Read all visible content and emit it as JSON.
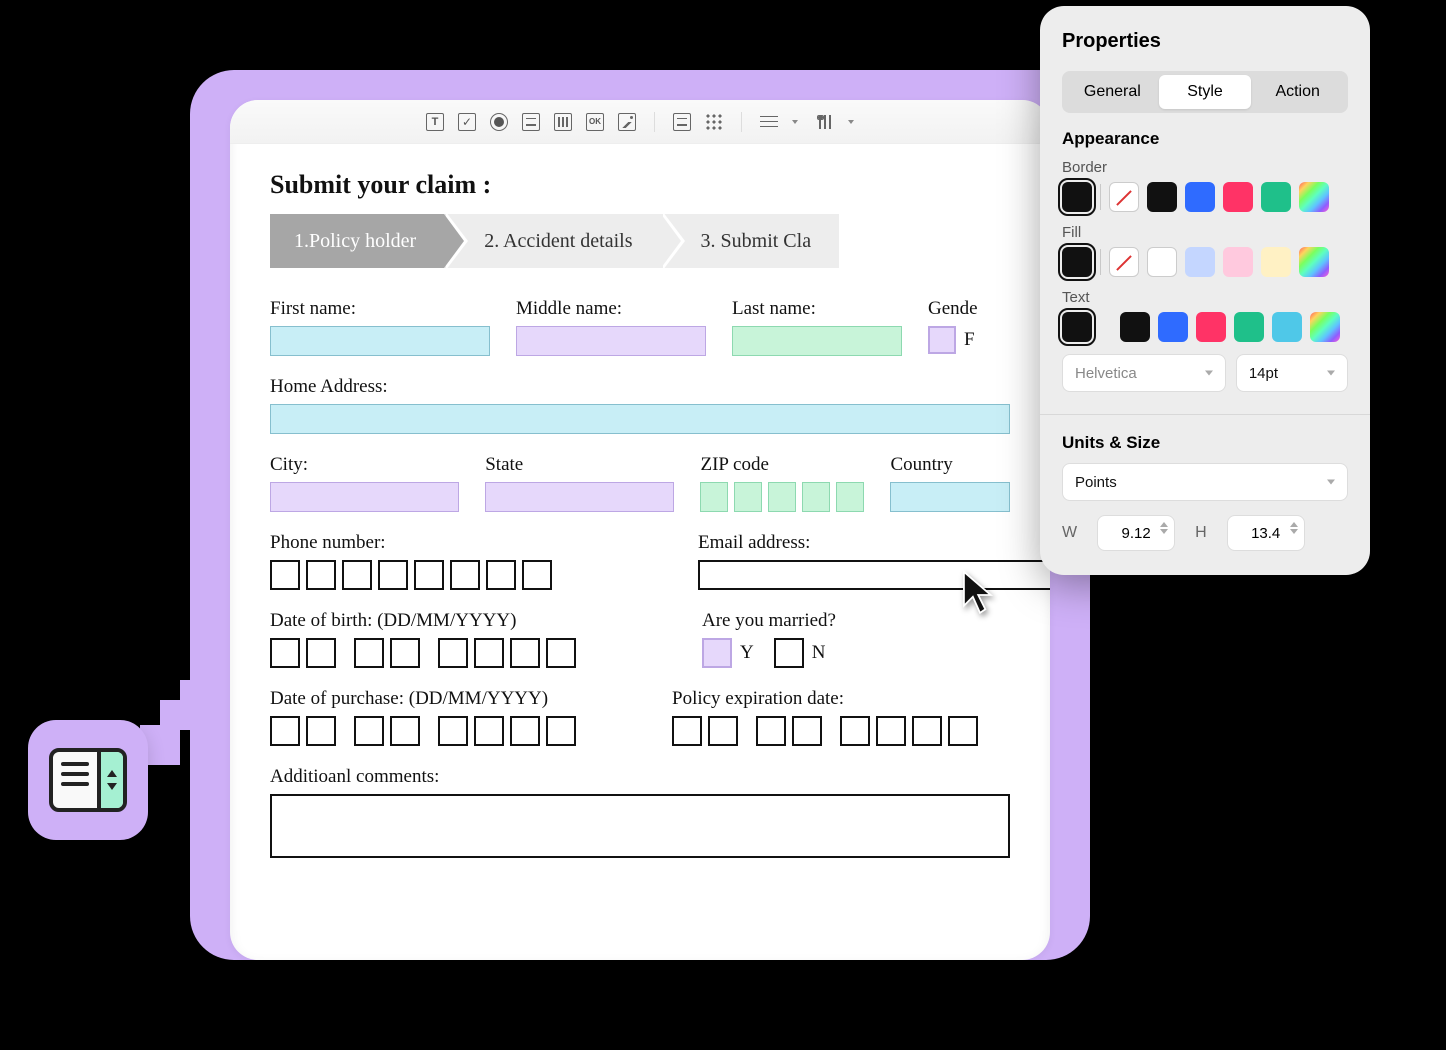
{
  "form": {
    "title": "Submit your claim :",
    "steps": [
      "1.Policy holder",
      "2. Accident details",
      "3. Submit Cla"
    ],
    "labels": {
      "first_name": "First name:",
      "middle_name": "Middle name:",
      "last_name": "Last name:",
      "gender": "Gende",
      "home_address": "Home Address:",
      "city": "City:",
      "state": "State",
      "zip": "ZIP code",
      "country": "Country",
      "phone": "Phone number:",
      "email": "Email address:",
      "dob": "Date of birth: (DD/MM/YYYY)",
      "married": "Are you married?",
      "dop": "Date of purchase: (DD/MM/YYYY)",
      "expiry": "Policy expiration date:",
      "comments": "Additioanl comments:"
    },
    "gender_value": "F",
    "married_yes": "Y",
    "married_no": "N"
  },
  "panel": {
    "title": "Properties",
    "tabs": {
      "general": "General",
      "style": "Style",
      "action": "Action"
    },
    "appearance": "Appearance",
    "border": "Border",
    "fill": "Fill",
    "text": "Text",
    "font": "Helvetica",
    "font_size": "14pt",
    "units_title": "Units & Size",
    "units": "Points",
    "w_label": "W",
    "h_label": "H",
    "w_value": "9.12",
    "h_value": "13.4"
  },
  "colors": {
    "border": [
      "black",
      "none",
      "white",
      "black",
      "blue",
      "pink",
      "green",
      "rainbow"
    ],
    "fill": [
      "black",
      "none",
      "white",
      "lblue",
      "lpink",
      "lyellow",
      "rainbow"
    ],
    "text": [
      "black",
      "black",
      "blue",
      "pink",
      "green",
      "cyan",
      "rainbow"
    ]
  }
}
